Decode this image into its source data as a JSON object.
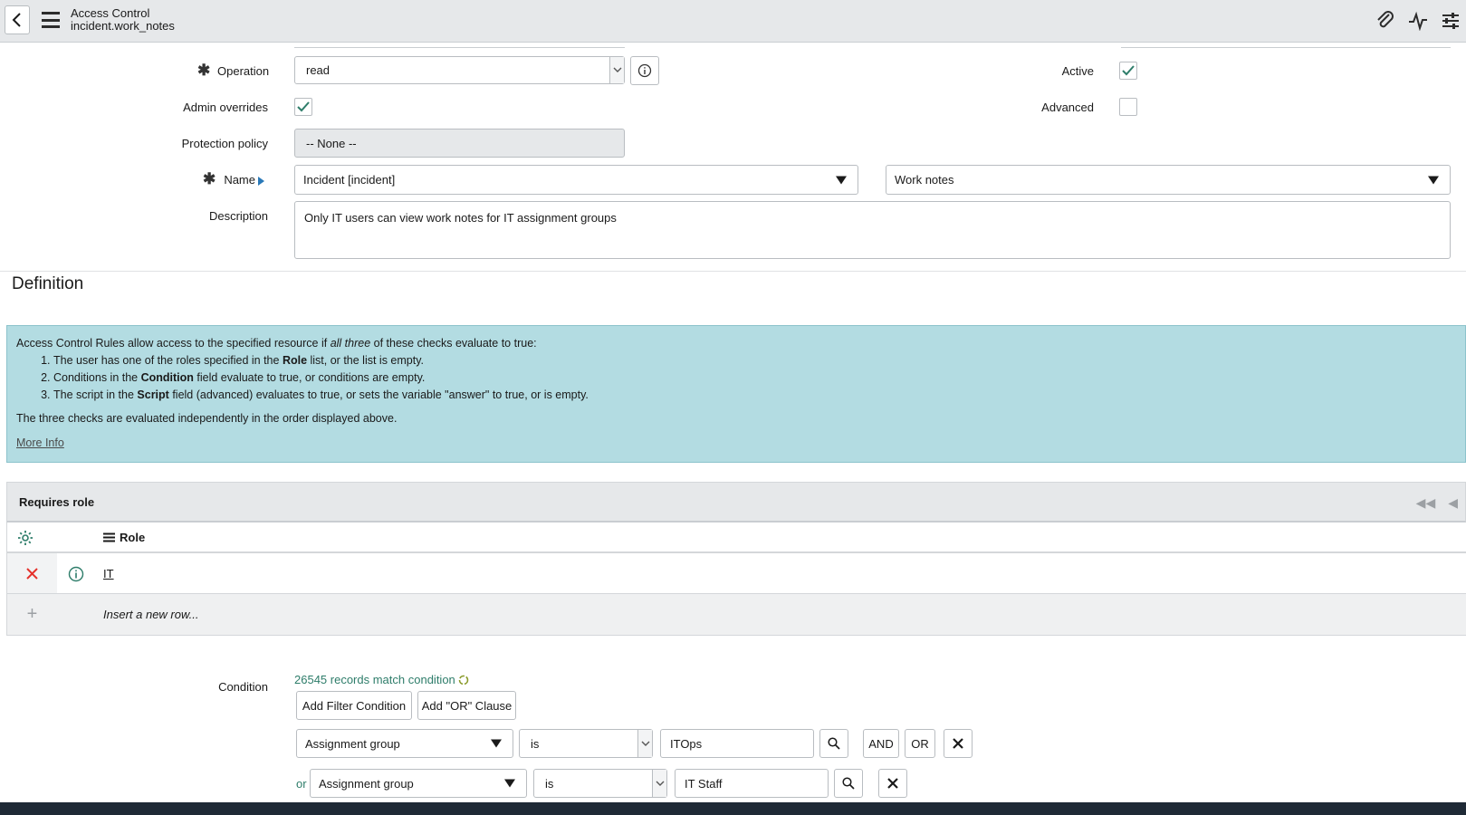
{
  "header": {
    "title": "Access Control",
    "subtitle": "incident.work_notes"
  },
  "form": {
    "operation": {
      "label": "Operation",
      "value": "read"
    },
    "admin_overrides": {
      "label": "Admin overrides",
      "checked": true
    },
    "protection_policy": {
      "label": "Protection policy",
      "value": "-- None --"
    },
    "name": {
      "label": "Name",
      "table": "Incident [incident]",
      "field": "Work notes"
    },
    "description": {
      "label": "Description",
      "value": "Only IT users can view work notes for IT assignment groups"
    },
    "active": {
      "label": "Active",
      "checked": true
    },
    "advanced": {
      "label": "Advanced",
      "checked": false
    }
  },
  "definition": {
    "title": "Definition",
    "intro_pre": "Access Control Rules allow access to the specified resource if ",
    "intro_em": "all three",
    "intro_post": " of these checks evaluate to true:",
    "items": [
      {
        "pre": "The user has one of the roles specified in the ",
        "bold": "Role",
        "post": " list, or the list is empty."
      },
      {
        "pre": "Conditions in the ",
        "bold": "Condition",
        "post": " field evaluate to true, or conditions are empty."
      },
      {
        "pre": "The script in the ",
        "bold": "Script",
        "post": " field (advanced) evaluates to true, or sets the variable \"answer\" to true, or is empty."
      }
    ],
    "footer": "The three checks are evaluated independently in the order displayed above.",
    "more_info": "More Info"
  },
  "related_list": {
    "title": "Requires role",
    "column": "Role",
    "rows": [
      {
        "role": "IT"
      }
    ],
    "insert_text": "Insert a new row..."
  },
  "condition": {
    "label": "Condition",
    "match_text": "26545 records match condition",
    "add_filter": "Add Filter Condition",
    "add_or": "Add \"OR\" Clause",
    "and_label": "AND",
    "or_label": "OR",
    "or_prefix": "or",
    "rows": [
      {
        "field": "Assignment group",
        "operator": "is",
        "value": "ITOps"
      },
      {
        "field": "Assignment group",
        "operator": "is",
        "value": "IT Staff"
      }
    ]
  },
  "colors": {
    "accent": "#2e7d6a",
    "info_bg": "#b3dce2",
    "delete": "#e5312b"
  }
}
